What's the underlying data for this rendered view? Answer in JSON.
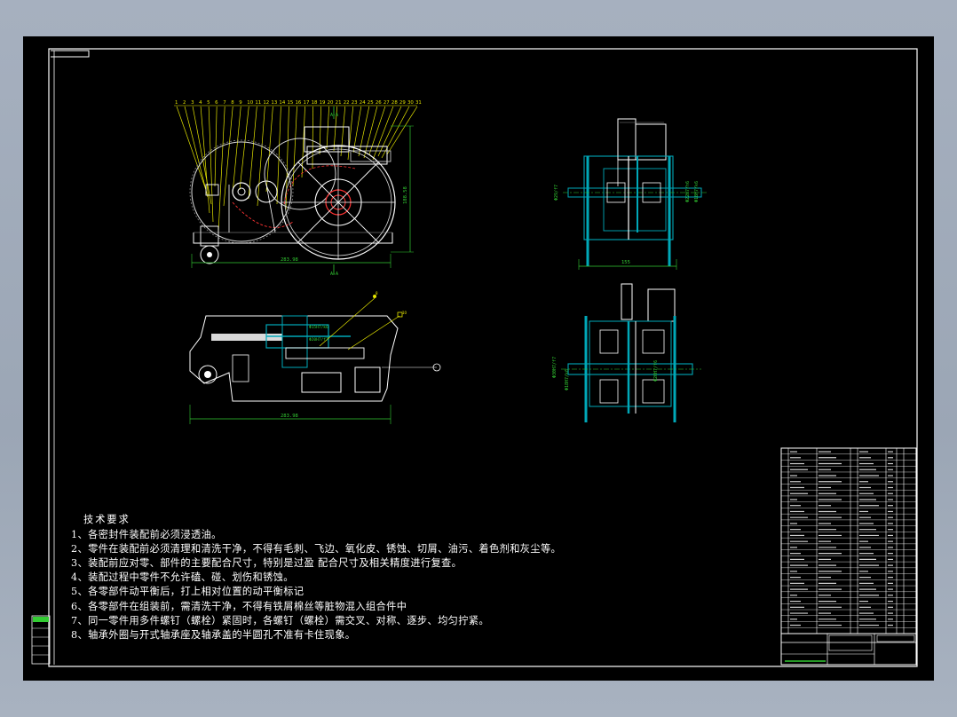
{
  "drawing": {
    "background_color": "#000000",
    "frame_color": "#ffffff",
    "dimension_color": "#33cc33",
    "leader_color": "#e6e600",
    "section_color": "#00a8b8",
    "cut_color": "#ff3333"
  },
  "views": {
    "front": {
      "balloons": [
        "1",
        "2",
        "3",
        "4",
        "5",
        "6",
        "7",
        "8",
        "9",
        "10",
        "11",
        "12",
        "13",
        "14",
        "15",
        "16",
        "17",
        "18",
        "19",
        "20",
        "21",
        "22",
        "23",
        "24",
        "25",
        "26",
        "27",
        "28",
        "29",
        "30",
        "31"
      ],
      "width_dim": "283.98",
      "height_dim": "188.58",
      "section_mark": "A-A"
    },
    "side": {
      "width_dim": "155",
      "dims": [
        "Φ29/f7",
        "Φ22H7/h6",
        "Φ18H7/k6"
      ]
    },
    "plan": {
      "width_dim": "283.98",
      "dims": [
        "Φ15H7/k6",
        "Φ20H7/f7"
      ],
      "balloons": [
        "8",
        "10"
      ]
    },
    "section": {
      "dims": [
        "Φ30H7/f7",
        "Φ18H7/k6",
        "Φ20H7/f6"
      ]
    }
  },
  "tech_requirements": {
    "title": "技术要求",
    "items": [
      "1、各密封件装配前必须浸透油。",
      "2、零件在装配前必须清理和清洗干净，不得有毛刺、飞边、氧化皮、锈蚀、切屑、油污、着色剂和灰尘等。",
      "3、装配前应对零、部件的主要配合尺寸，特别是过盈 配合尺寸及相关精度进行复查。",
      "4、装配过程中零件不允许磕、碰、划伤和锈蚀。",
      "5、各零部件动平衡后，打上相对位置的动平衡标记",
      "6、各零部件在组装前，需清洗干净，不得有铁屑棉丝等脏物混入组合件中",
      "7、同一零件用多件螺钉（螺栓）紧固时，各螺钉（螺栓）需交叉、对称、逐步、均匀拧紧。",
      "8、轴承外圈与开式轴承座及轴承盖的半圆孔不准有卡住现象。"
    ]
  }
}
